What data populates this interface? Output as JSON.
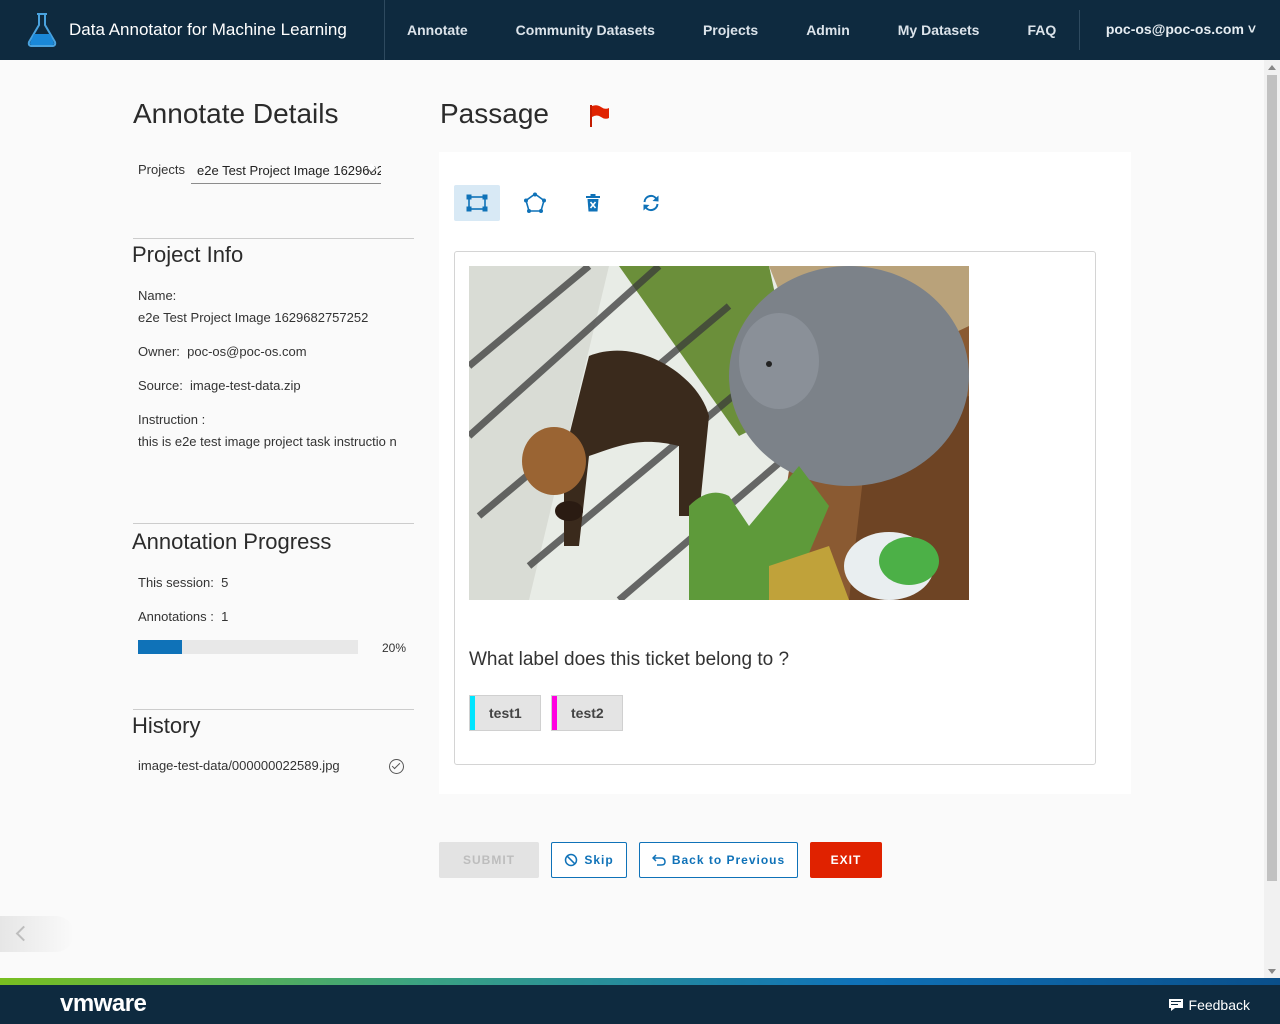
{
  "app": {
    "title": "Data Annotator for Machine Learning",
    "nav": [
      "Annotate",
      "Community Datasets",
      "Projects",
      "Admin",
      "My Datasets",
      "FAQ"
    ],
    "user": "poc-os@poc-os.com ˅"
  },
  "left": {
    "heading": "Annotate Details",
    "projects_label": "Projects",
    "project_selected": "e2e Test Project Image 1629682757252",
    "project_info": {
      "title": "Project Info",
      "name_label": "Name:",
      "name_value": "e2e Test Project Image 1629682757252",
      "owner_label": "Owner:",
      "owner_value": "poc-os@poc-os.com",
      "source_label": "Source:",
      "source_value": "image-test-data.zip",
      "instruction_label": "Instruction :",
      "instruction_value": "this is e2e test image project task instructio n"
    },
    "progress": {
      "title": "Annotation Progress",
      "session_label": "This session:",
      "session_value": "5",
      "annotations_label": "Annotations :",
      "annotations_value": "1",
      "percent": 20,
      "percent_label": "20%"
    },
    "history": {
      "title": "History",
      "items": [
        "image-test-data/000000022589.jpg"
      ]
    }
  },
  "main": {
    "heading": "Passage",
    "tools": [
      "rectangle-tool",
      "polygon-tool",
      "delete-tool",
      "reset-tool"
    ],
    "question": "What label does this ticket belong to ?",
    "labels": [
      {
        "text": "test1",
        "color": "#00e5ff"
      },
      {
        "text": "test2",
        "color": "#ff00e0"
      }
    ]
  },
  "buttons": {
    "submit": "SUBMIT",
    "skip": "Skip",
    "back": "Back to Previous",
    "exit": "EXIT"
  },
  "footer": {
    "brand": "vmware",
    "feedback": "Feedback"
  },
  "colors": {
    "header_bg": "#0e2a3f",
    "accent": "#0f72b8",
    "exit": "#e02200",
    "flag": "#e02200"
  }
}
